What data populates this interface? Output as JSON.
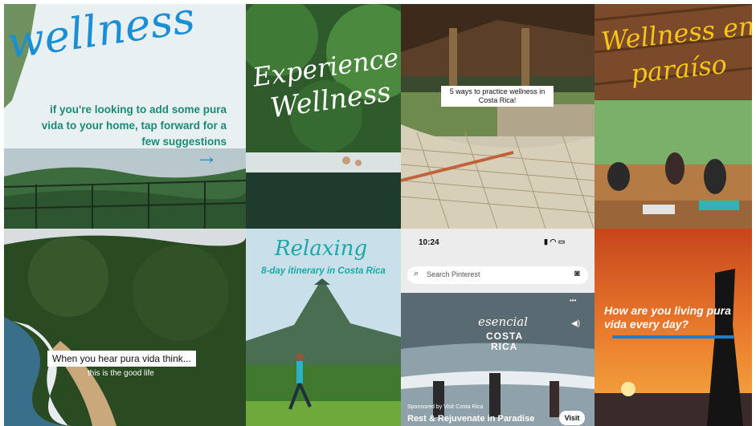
{
  "tiles": {
    "t1": {
      "script": "wellness",
      "body": "if you're looking to add some pura vida to your home, tap forward for a few suggestions",
      "arrow": "→",
      "script_color": "#1b8fd6",
      "body_color": "#1a8a78"
    },
    "t2": {
      "script_line1": "Experience",
      "script_line2": "Wellness"
    },
    "t3": {
      "caption": "5 ways to practice wellness in Costa Rica!"
    },
    "t4": {
      "script_line1": "Wellness en",
      "script_line2": "paraíso",
      "script_color": "#f5c518"
    },
    "t5": {
      "caption": "When you hear pura vida think...",
      "sub": "this is the good life"
    },
    "t6": {
      "script": "Relaxing",
      "sub": "8-day itinerary in Costa Rica",
      "script_color": "#1aa9a8"
    },
    "t7": {
      "time": "10:24",
      "search_placeholder": "Search Pinterest",
      "brand_line1": "esencial",
      "brand_line2": "COSTA",
      "brand_line3": "RICA",
      "sponsor": "Sponsored by Visit Costa Rica",
      "title": "Rest & Rejuvenate in Paradise",
      "visit_label": "Visit",
      "more": "•••"
    },
    "t8": {
      "caption": "How are you living pura vida every day?",
      "bar_color": "#1a7fd0"
    }
  }
}
